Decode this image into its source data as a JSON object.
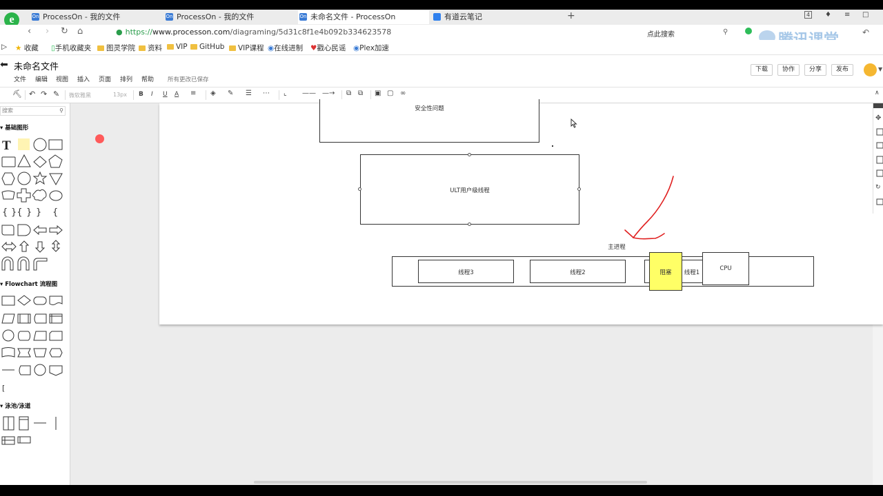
{
  "browser": {
    "tabs": [
      {
        "title": "ProcessOn - 我的文件",
        "favicon": "On"
      },
      {
        "title": "ProcessOn - 我的文件",
        "favicon": "On"
      },
      {
        "title": "未命名文件 - ProcessOn",
        "favicon": "On"
      },
      {
        "title": "有道云笔记",
        "favicon": "note-icon"
      }
    ],
    "new_tab": "+",
    "tab_count": "4",
    "url_scheme": "https://",
    "url_domain": "www.processon.com",
    "url_path": "/diagraming/5d31c8f1e4b092b334623578",
    "search_placeholder": "点此搜索",
    "bookmarks": [
      "收藏",
      "手机收藏夹",
      "图灵学院",
      "资料",
      "VIP",
      "GitHub",
      "VIP课程",
      "在线进制",
      "戳心民谣",
      "Plex加速"
    ],
    "watermark": "腾讯课堂"
  },
  "app": {
    "title": "未命名文件",
    "menu": [
      "文件",
      "编辑",
      "视图",
      "插入",
      "页面",
      "排列",
      "帮助"
    ],
    "save_status": "所有更改已保存",
    "buttons": [
      "下载",
      "协作",
      "分享",
      "发布"
    ],
    "toolbar": {
      "font_family": "微软雅黑",
      "font_size": "13px",
      "bold": "B",
      "italic": "I",
      "underline": "U",
      "font_color": "A"
    }
  },
  "sidebar": {
    "search_placeholder": "搜索",
    "categories": [
      "基础图形",
      "Flowchart 流程图",
      "泳池/泳道"
    ]
  },
  "diagram": {
    "top_box_label": "安全性问题",
    "ult_box_label": "ULT用户级线程",
    "main_process_label": "主进程",
    "thread3": "线程3",
    "thread2": "线程2",
    "blocked": "阻塞",
    "thread1": "线程1",
    "cpu": "CPU",
    "colors": {
      "blocked_fill": "#ffff66",
      "annotation": "#e02020",
      "pointer_dot": "#ff5a5a"
    }
  }
}
